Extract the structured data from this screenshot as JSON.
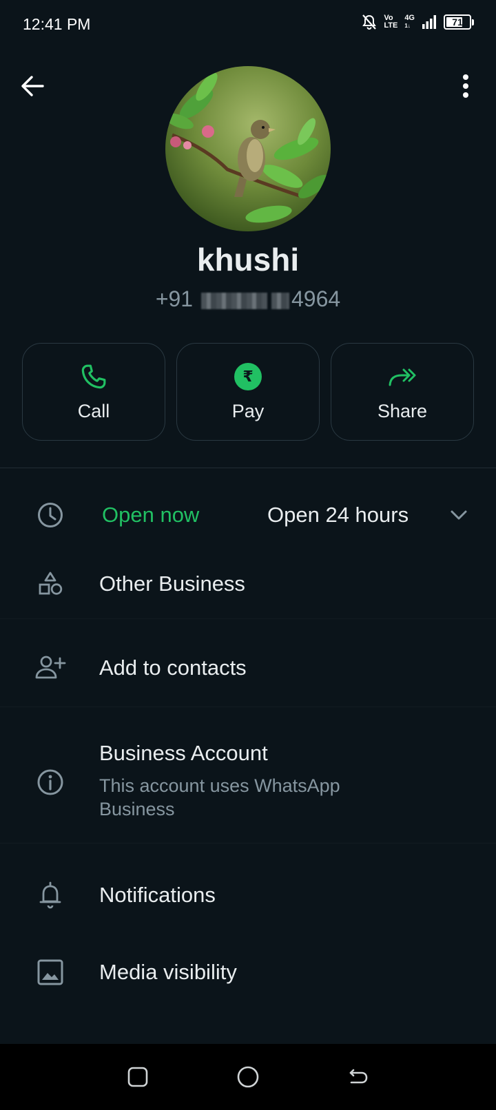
{
  "status_bar": {
    "time": "12:41 PM",
    "volte_top": "Vo",
    "volte_bottom": "LTE",
    "network_top": "4G",
    "network_bottom": "1↓",
    "battery_level": "71",
    "battery_fraction": 0.71
  },
  "profile": {
    "name": "khushi",
    "phone_prefix": "+91",
    "phone_suffix": "4964"
  },
  "actions": [
    {
      "label": "Call",
      "icon": "phone-icon"
    },
    {
      "label": "Pay",
      "icon": "rupee-icon",
      "symbol": "₹"
    },
    {
      "label": "Share",
      "icon": "share-forward-icon"
    }
  ],
  "hours": {
    "status": "Open now",
    "value": "Open 24 hours"
  },
  "rows": {
    "category": "Other Business",
    "add_contact": "Add to contacts",
    "business_title": "Business Account",
    "business_sub": "This account uses WhatsApp Business",
    "notifications": "Notifications",
    "media": "Media visibility"
  },
  "colors": {
    "background": "#0b141a",
    "accent": "#21c063",
    "text_primary": "#e9edef",
    "text_secondary": "#8696a0",
    "border": "#2a3942"
  }
}
